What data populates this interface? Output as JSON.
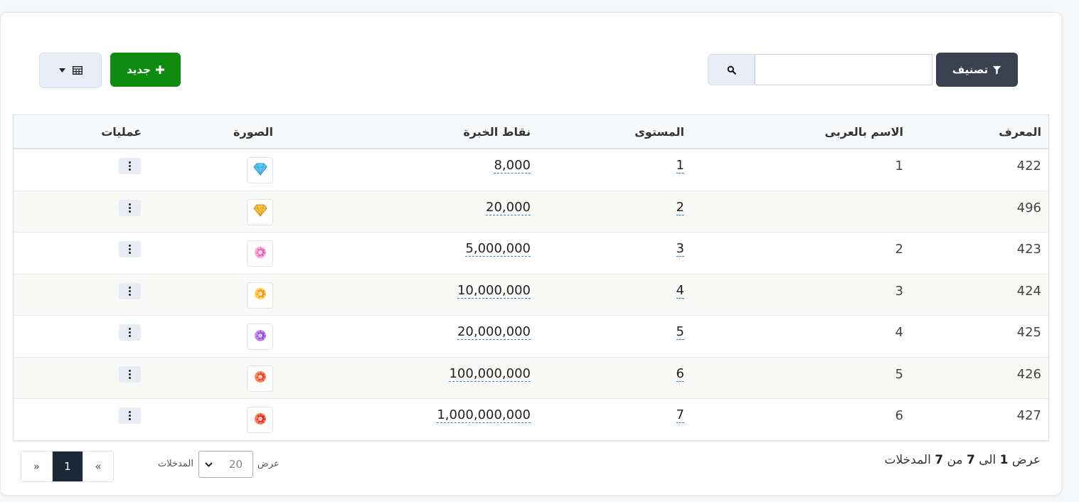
{
  "toolbar": {
    "filter_label": "تصنيف",
    "new_label": "جديد",
    "search_value": ""
  },
  "table": {
    "headers": {
      "id": "المعرف",
      "name_ar": "الاسم بالعربى",
      "level": "المستوى",
      "xp": "نقاط الخبرة",
      "image": "الصورة",
      "ops": "عمليات"
    },
    "rows": [
      {
        "id": "422",
        "name_ar": "1",
        "level": "1",
        "xp": "8,000",
        "icon": "diamond-blue-icon"
      },
      {
        "id": "496",
        "name_ar": "",
        "level": "2",
        "xp": "20,000",
        "icon": "diamond-gold-icon"
      },
      {
        "id": "423",
        "name_ar": "2",
        "level": "3",
        "xp": "5,000,000",
        "icon": "badge-pink-icon"
      },
      {
        "id": "424",
        "name_ar": "3",
        "level": "4",
        "xp": "10,000,000",
        "icon": "badge-gold-icon"
      },
      {
        "id": "425",
        "name_ar": "4",
        "level": "5",
        "xp": "20,000,000",
        "icon": "badge-purple-icon"
      },
      {
        "id": "426",
        "name_ar": "5",
        "level": "6",
        "xp": "100,000,000",
        "icon": "badge-red-icon"
      },
      {
        "id": "427",
        "name_ar": "6",
        "level": "7",
        "xp": "1,000,000,000",
        "icon": "badge-red-crown-icon"
      }
    ]
  },
  "footer": {
    "summary_prefix": "عرض",
    "summary_from": "1",
    "summary_to_word": "الى",
    "summary_to": "7",
    "summary_of_word": "من",
    "summary_total": "7",
    "summary_suffix": "المدخلات",
    "length_label_show": "عرض",
    "length_value": "20",
    "length_label_entries": "المدخلات",
    "pager_prev": "«",
    "pager_current": "1",
    "pager_next": "»"
  },
  "colors": {
    "filter_bg": "#394150",
    "new_bg": "#0e8a0e",
    "search_bg": "#e8edf8",
    "pager_active": "#1b2838",
    "link_underline": "#3c82c8"
  }
}
